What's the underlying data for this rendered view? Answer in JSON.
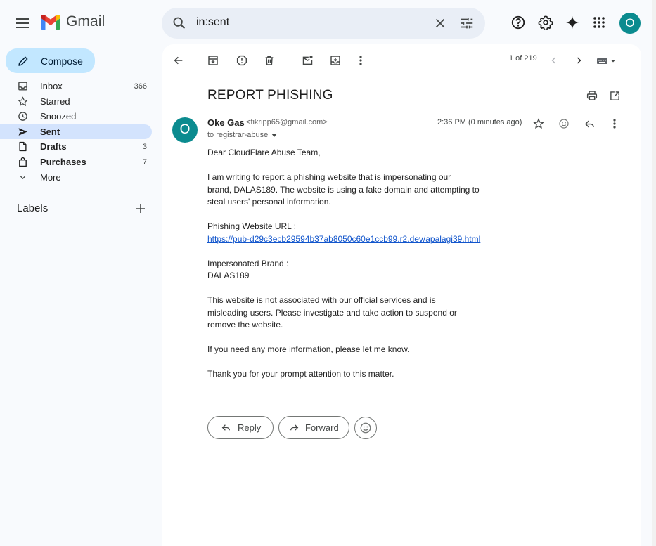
{
  "app": {
    "name": "Gmail",
    "brand_colors": {
      "red": "#ea4335",
      "blue": "#4285f4",
      "green": "#34a853",
      "yellow": "#fbbc04",
      "avatar": "#0b8b8f",
      "compose_bg": "#c2e7ff",
      "active_nav": "#d3e3fd"
    }
  },
  "header": {
    "search_value": "in:sent",
    "account_initial": "O",
    "icons": [
      "menu-icon",
      "search-icon",
      "clear-search-icon",
      "search-options-icon",
      "help-icon",
      "settings-icon",
      "gemini-icon",
      "apps-icon"
    ]
  },
  "sidebar": {
    "compose_label": "Compose",
    "items": [
      {
        "label": "Inbox",
        "count": "366",
        "icon": "inbox-icon",
        "bold": true,
        "active": false
      },
      {
        "label": "Starred",
        "count": "",
        "icon": "star-icon",
        "bold": false,
        "active": false
      },
      {
        "label": "Snoozed",
        "count": "",
        "icon": "clock-icon",
        "bold": false,
        "active": false
      },
      {
        "label": "Sent",
        "count": "",
        "icon": "send-icon",
        "bold": true,
        "active": true
      },
      {
        "label": "Drafts",
        "count": "3",
        "icon": "draft-icon",
        "bold": true,
        "active": false
      },
      {
        "label": "Purchases",
        "count": "7",
        "icon": "purchases-icon",
        "bold": true,
        "active": false
      },
      {
        "label": "More",
        "count": "",
        "icon": "chevron-down-icon",
        "bold": false,
        "active": false
      }
    ],
    "labels_heading": "Labels"
  },
  "toolbar": {
    "pager": "1 of 219"
  },
  "message": {
    "subject": "REPORT PHISHING",
    "sender_initial": "O",
    "sender_name": "Oke Gas",
    "sender_email": "<fikripp65@gmail.com>",
    "to_line": "to registrar-abuse",
    "time": "2:36 PM (0 minutes ago)",
    "body": {
      "greeting": "Dear CloudFlare Abuse Team,",
      "intro": "I am writing to report a phishing website that is impersonating our\nbrand, DALAS189. The website is using a fake domain and attempting to\nsteal users' personal information.",
      "url_label": "Phishing Website URL :",
      "url": "https://pub-d29c3ecb29594b37ab8050c60e1ccb99.r2.dev/apalagi39.html",
      "brand_label": "Impersonated Brand :",
      "brand": "DALAS189",
      "para3": "This website is not associated with our official services and is\nmisleading users. Please investigate and take action to suspend or\nremove the website.",
      "para4": "If you need any more information, please let me know.",
      "closing": "Thank you for your prompt attention to this matter."
    },
    "reply_label": "Reply",
    "forward_label": "Forward"
  }
}
